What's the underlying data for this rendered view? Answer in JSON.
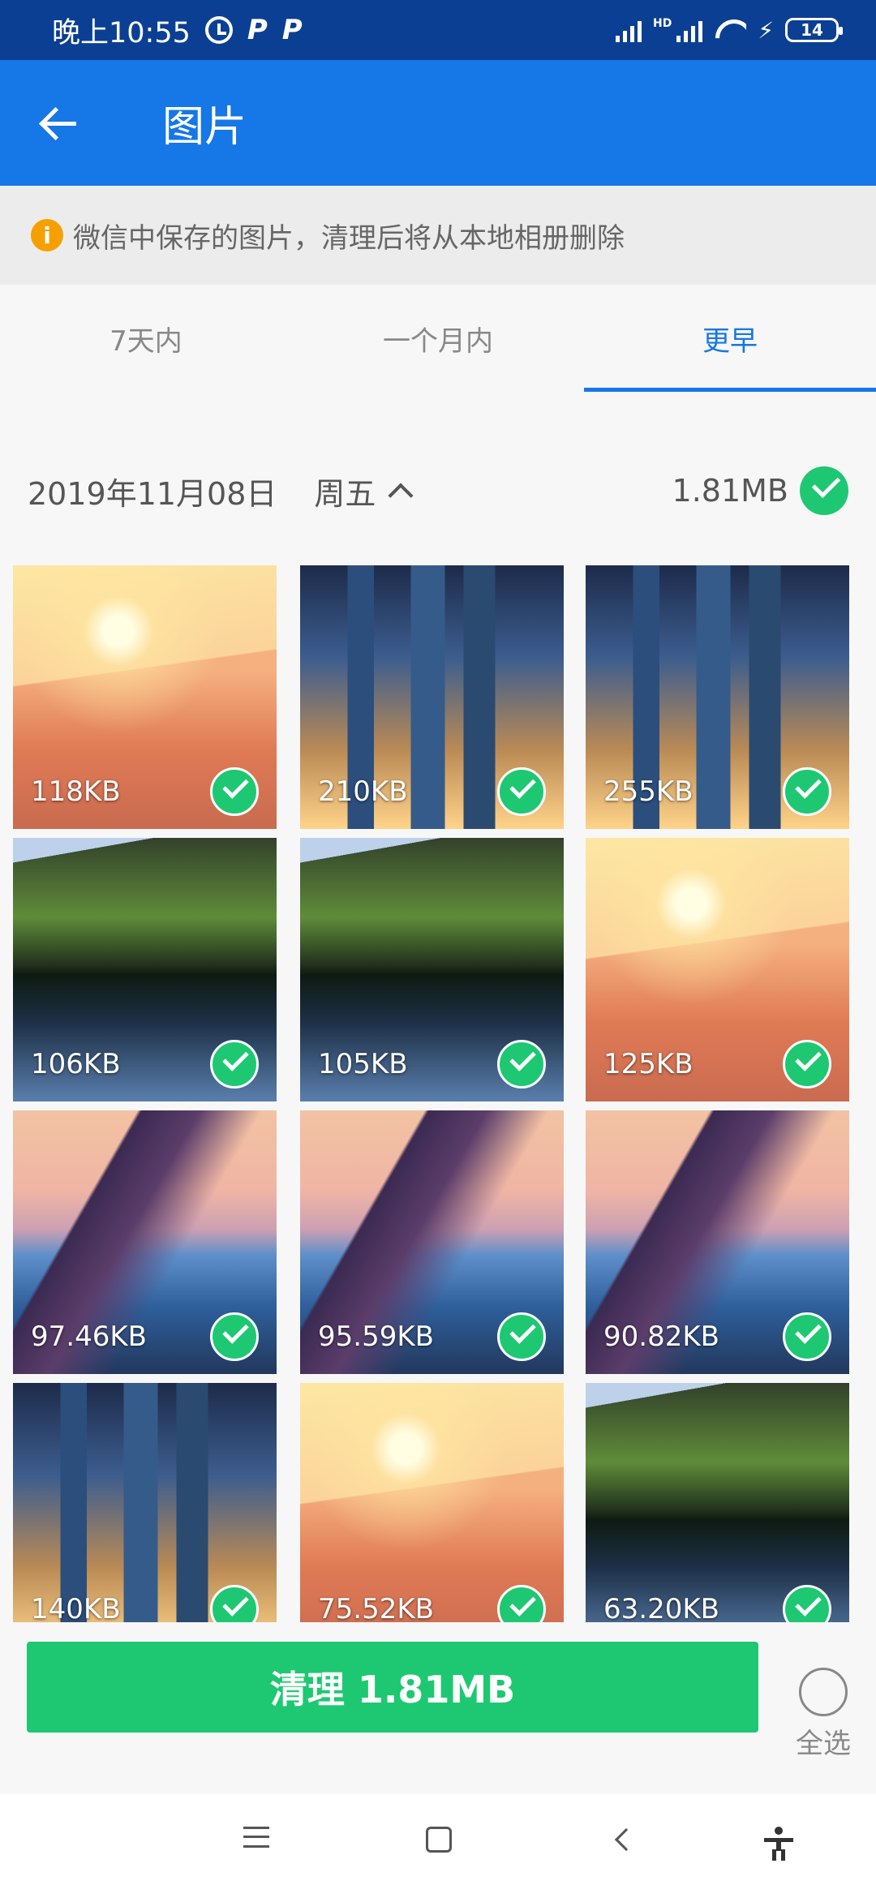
{
  "status_bar": {
    "time": "晚上10:55",
    "p_icons": [
      "P",
      "P"
    ],
    "hd": "HD",
    "battery": "14"
  },
  "app_bar": {
    "title": "图片"
  },
  "notice": {
    "text": "微信中保存的图片，清理后将从本地相册删除",
    "icon": "i"
  },
  "tabs": [
    {
      "label": "7天内",
      "active": false
    },
    {
      "label": "一个月内",
      "active": false
    },
    {
      "label": "更早",
      "active": true
    }
  ],
  "group": {
    "date": "2019年11月08日",
    "weekday": "周五",
    "total_size": "1.81MB"
  },
  "images": [
    {
      "size": "118KB",
      "scene": "desert"
    },
    {
      "size": "210KB",
      "scene": "city"
    },
    {
      "size": "255KB",
      "scene": "city"
    },
    {
      "size": "106KB",
      "scene": "lake"
    },
    {
      "size": "105KB",
      "scene": "lake"
    },
    {
      "size": "125KB",
      "scene": "desert"
    },
    {
      "size": "97.46KB",
      "scene": "mountain"
    },
    {
      "size": "95.59KB",
      "scene": "mountain"
    },
    {
      "size": "90.82KB",
      "scene": "mountain"
    },
    {
      "size": "140KB",
      "scene": "city"
    },
    {
      "size": "75.52KB",
      "scene": "desert"
    },
    {
      "size": "63.20KB",
      "scene": "lake"
    }
  ],
  "actions": {
    "clean_label": "清理 1.81MB",
    "select_all_label": "全选"
  },
  "colors": {
    "primary": "#1677e6",
    "success": "#1ec872",
    "status_bar": "#0b3f93"
  }
}
